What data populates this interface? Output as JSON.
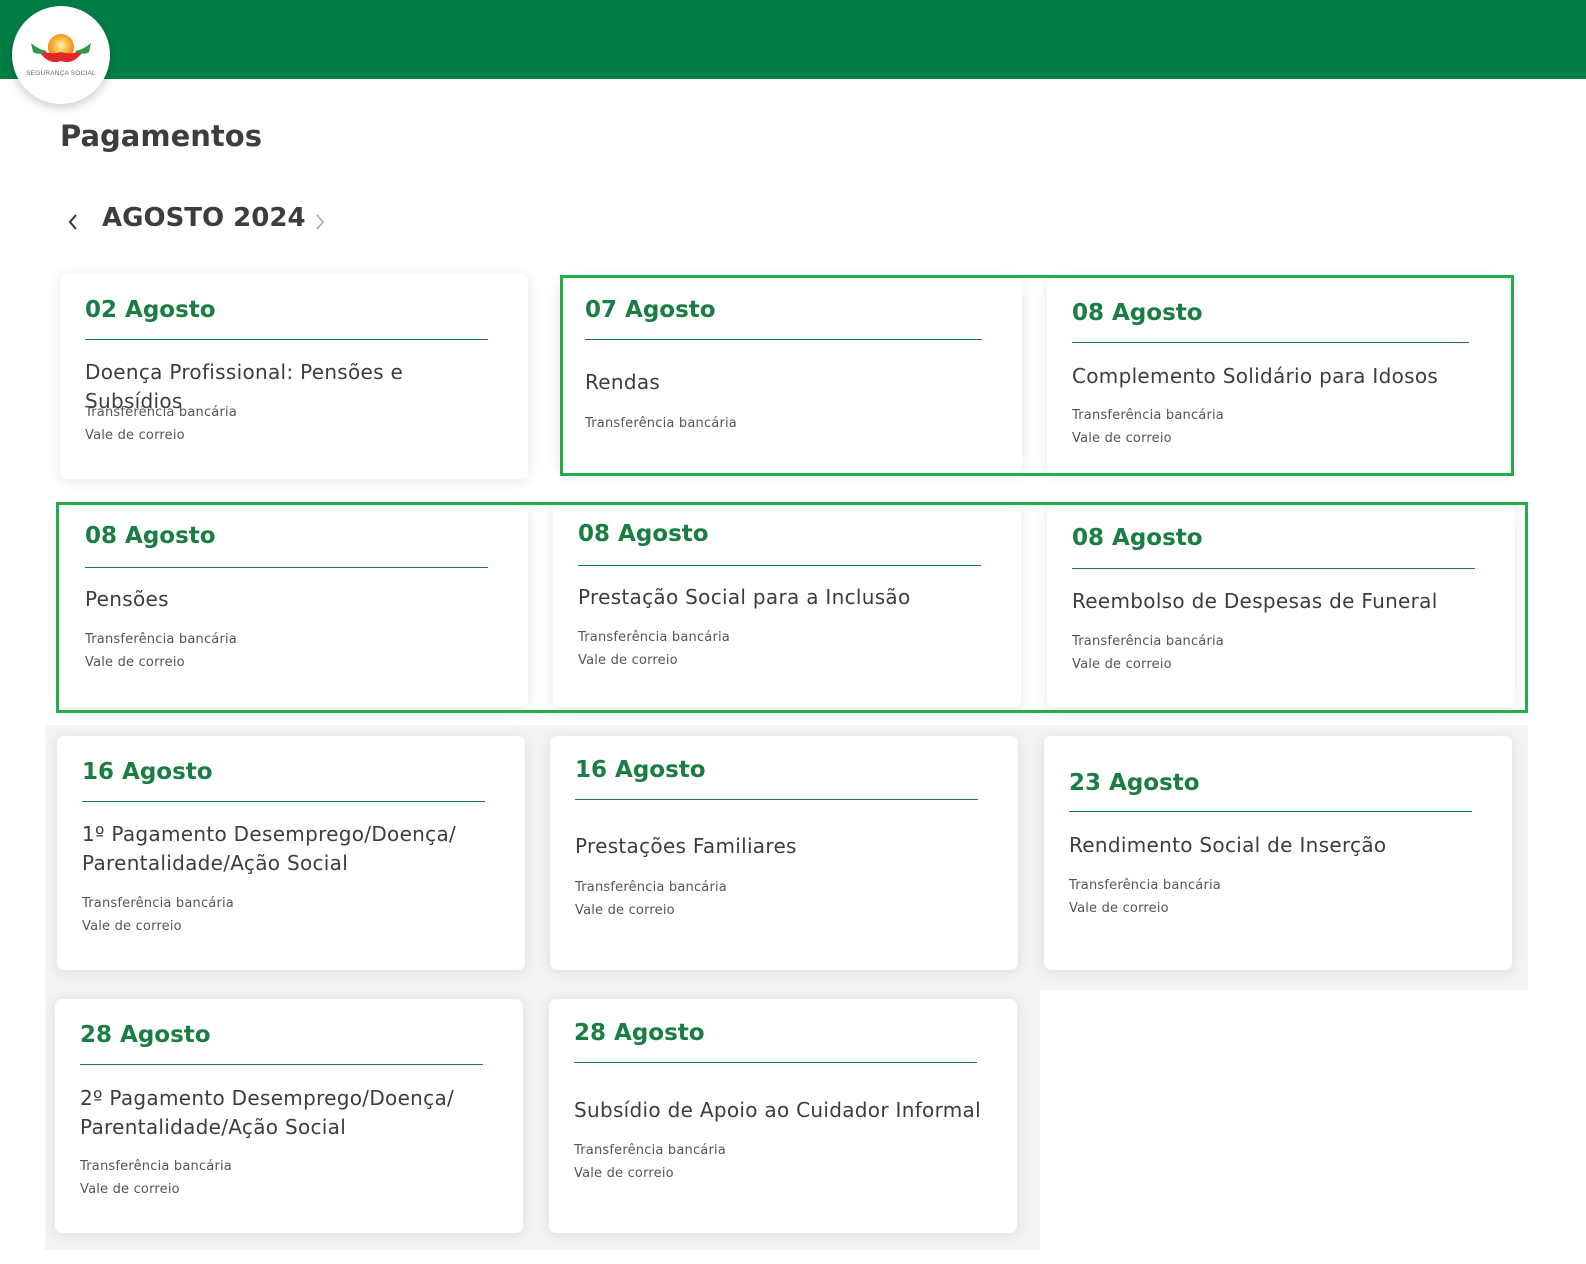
{
  "app": {
    "logo_text": "SEGURANÇA SOCIAL",
    "brand_color": "#007e45",
    "accent_color": "#1a7d44",
    "highlight_color": "#22ae4c"
  },
  "page": {
    "title": "Pagamentos",
    "month": "AGOSTO 2024",
    "prev_icon": "chevron-left-icon",
    "next_icon": "chevron-right-icon"
  },
  "payments": [
    {
      "date": "02 Agosto",
      "title": "Doença Profissional: Pensões e Subsídios",
      "methods": [
        "Transferência bancária",
        "Vale de correio"
      ]
    },
    {
      "date": "07 Agosto",
      "title": "Rendas",
      "methods": [
        "Transferência bancária"
      ]
    },
    {
      "date": "08 Agosto",
      "title": "Complemento Solidário para Idosos",
      "methods": [
        "Transferência bancária",
        "Vale de correio"
      ]
    },
    {
      "date": "08 Agosto",
      "title": "Pensões",
      "methods": [
        "Transferência bancária",
        "Vale de correio"
      ]
    },
    {
      "date": "08 Agosto",
      "title": "Prestação Social para a Inclusão",
      "methods": [
        "Transferência bancária",
        "Vale de correio"
      ]
    },
    {
      "date": "08 Agosto",
      "title": "Reembolso de Despesas de Funeral",
      "methods": [
        "Transferência bancária",
        "Vale de correio"
      ]
    },
    {
      "date": "16 Agosto",
      "title": "1º Pagamento Desemprego/Doença/ Parentalidade/Ação Social",
      "methods": [
        "Transferência bancária",
        "Vale de correio"
      ]
    },
    {
      "date": "16 Agosto",
      "title": "Prestações Familiares",
      "methods": [
        "Transferência bancária",
        "Vale de correio"
      ]
    },
    {
      "date": "23 Agosto",
      "title": "Rendimento Social de Inserção",
      "methods": [
        "Transferência bancária",
        "Vale de correio"
      ]
    },
    {
      "date": "28 Agosto",
      "title": "2º Pagamento Desemprego/Doença/ Parentalidade/Ação Social",
      "methods": [
        "Transferência bancária",
        "Vale de correio"
      ]
    },
    {
      "date": "28 Agosto",
      "title": "Subsídio de Apoio ao Cuidador Informal",
      "methods": [
        "Transferência bancária",
        "Vale de correio"
      ]
    }
  ]
}
